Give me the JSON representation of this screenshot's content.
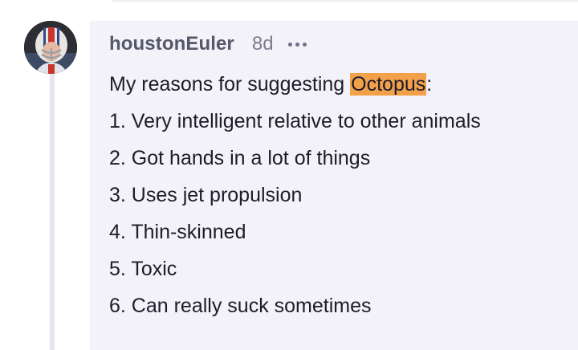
{
  "comment": {
    "username": "houstonEuler",
    "timestamp": "8d",
    "more_icon": "ellipsis-icon",
    "intro_prefix": "My reasons for suggesting ",
    "intro_highlight": "Octopus",
    "intro_suffix": ":",
    "highlight_color": "#f2a04a",
    "reasons": [
      "1. Very intelligent relative to other animals",
      "2. Got hands in a lot of things",
      "3. Uses jet propulsion",
      "4. Thin-skinned",
      "5. Toxic",
      "6. Can really suck sometimes"
    ]
  },
  "colors": {
    "card_background": "#f3f2f8",
    "username": "#57576b",
    "timestamp": "#7c7c90",
    "body_text": "#1c1c2a"
  }
}
